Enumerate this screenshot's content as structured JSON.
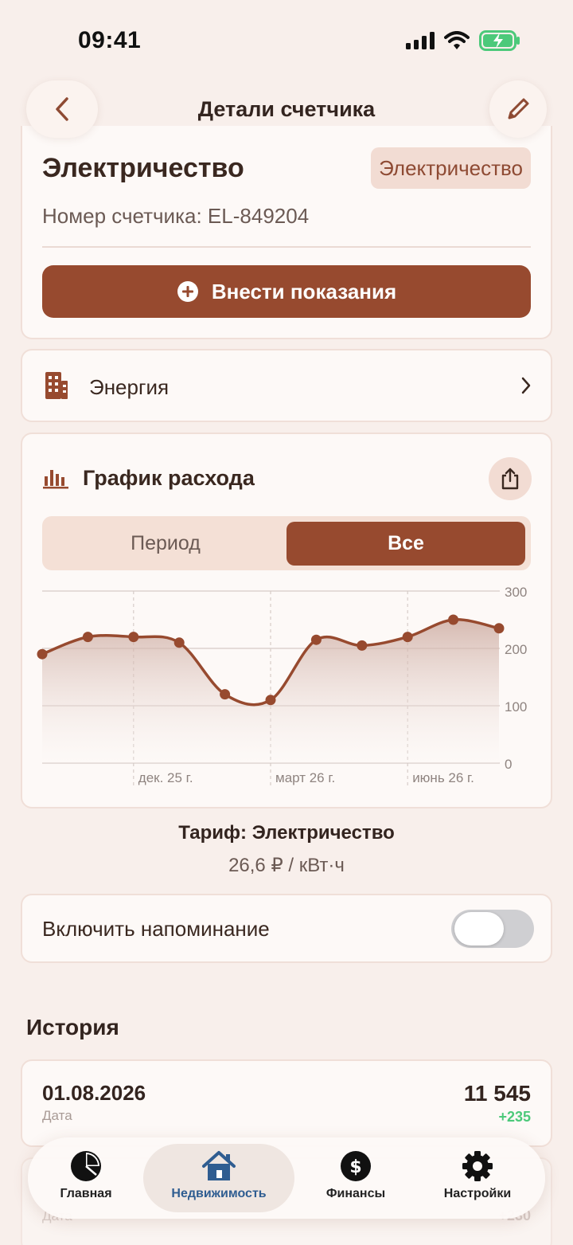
{
  "status_bar": {
    "time": "09:41"
  },
  "header": {
    "title": "Детали счетчика"
  },
  "meter": {
    "name": "Электричество",
    "type_badge": "Электричество",
    "number_label": "Номер счетчика: EL-849204",
    "add_reading_label": "Внести показания"
  },
  "category": {
    "label": "Энергия"
  },
  "chart_section": {
    "title": "График расхода",
    "segments": [
      "Период",
      "Все"
    ],
    "selected_segment": "Все"
  },
  "chart_data": {
    "type": "area",
    "x_tick_labels": [
      "дек. 25 г.",
      "март 26 г.",
      "июнь 26 г."
    ],
    "y_tick_labels": [
      "300",
      "200",
      "100",
      "0"
    ],
    "ylim": [
      0,
      300
    ],
    "values": [
      190,
      220,
      220,
      210,
      120,
      110,
      215,
      205,
      220,
      250,
      235
    ],
    "grid": true,
    "line_color": "#974a2f"
  },
  "tariff": {
    "title": "Тариф: Электричество",
    "rate": "26,6 ₽ / кВт·ч"
  },
  "reminder": {
    "label": "Включить напоминание",
    "enabled": false
  },
  "history": {
    "title": "История",
    "entries": [
      {
        "date": "01.08.2026",
        "date_label": "Дата",
        "value": "11 545",
        "delta": "+235"
      },
      {
        "date": "",
        "date_label": "Дата",
        "value": "",
        "delta": "+230"
      }
    ]
  },
  "tab_bar": {
    "active": "Недвижимость",
    "items": [
      {
        "label": "Главная",
        "icon": "pie-chart-icon"
      },
      {
        "label": "Недвижимость",
        "icon": "house-icon"
      },
      {
        "label": "Финансы",
        "icon": "dollar-icon"
      },
      {
        "label": "Настройки",
        "icon": "gear-icon"
      }
    ]
  },
  "colors": {
    "accent": "#974a2f",
    "background": "#f8efeb",
    "active_tab": "#2f5d91",
    "positive": "#4cc97a"
  }
}
